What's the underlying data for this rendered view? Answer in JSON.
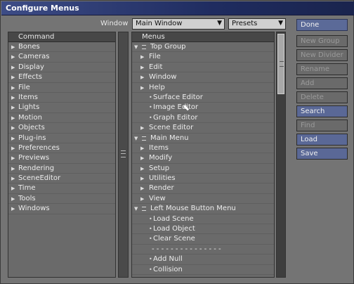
{
  "window_title": "Configure Menus",
  "top_bar": {
    "window_label": "Window",
    "window_value": "Main Window",
    "presets_value": "Presets"
  },
  "command_panel": {
    "header": "Command",
    "items": [
      "Bones",
      "Cameras",
      "Display",
      "Effects",
      "File",
      "Items",
      "Lights",
      "Motion",
      "Objects",
      "Plug-ins",
      "Preferences",
      "Previews",
      "Rendering",
      "SceneEditor",
      "Time",
      "Tools",
      "Windows"
    ]
  },
  "menus_panel": {
    "header": "Menus",
    "items": [
      "Top Group",
      "File",
      "Edit",
      "Window",
      "Help",
      "Surface Editor",
      "Image Editor",
      "Graph Editor",
      "Scene Editor",
      "Main Menu",
      "Items",
      "Modify",
      "Setup",
      "Utilities",
      "Render",
      "View",
      "Left Mouse Button Menu",
      "Load Scene",
      "Load Object",
      "Clear Scene",
      "- - - - - - - - - - - - - - -",
      "Add Null",
      "Collision"
    ]
  },
  "buttons": {
    "done": "Done",
    "new_group": "New Group",
    "new_divider": "New Divider",
    "rename": "Rename",
    "add": "Add",
    "delete": "Delete",
    "search": "Search",
    "find": "Find",
    "load": "Load",
    "save": "Save"
  },
  "icons": {
    "expand": "triangle-right-icon",
    "collapse": "triangle-down-icon",
    "group": "group-icon"
  }
}
